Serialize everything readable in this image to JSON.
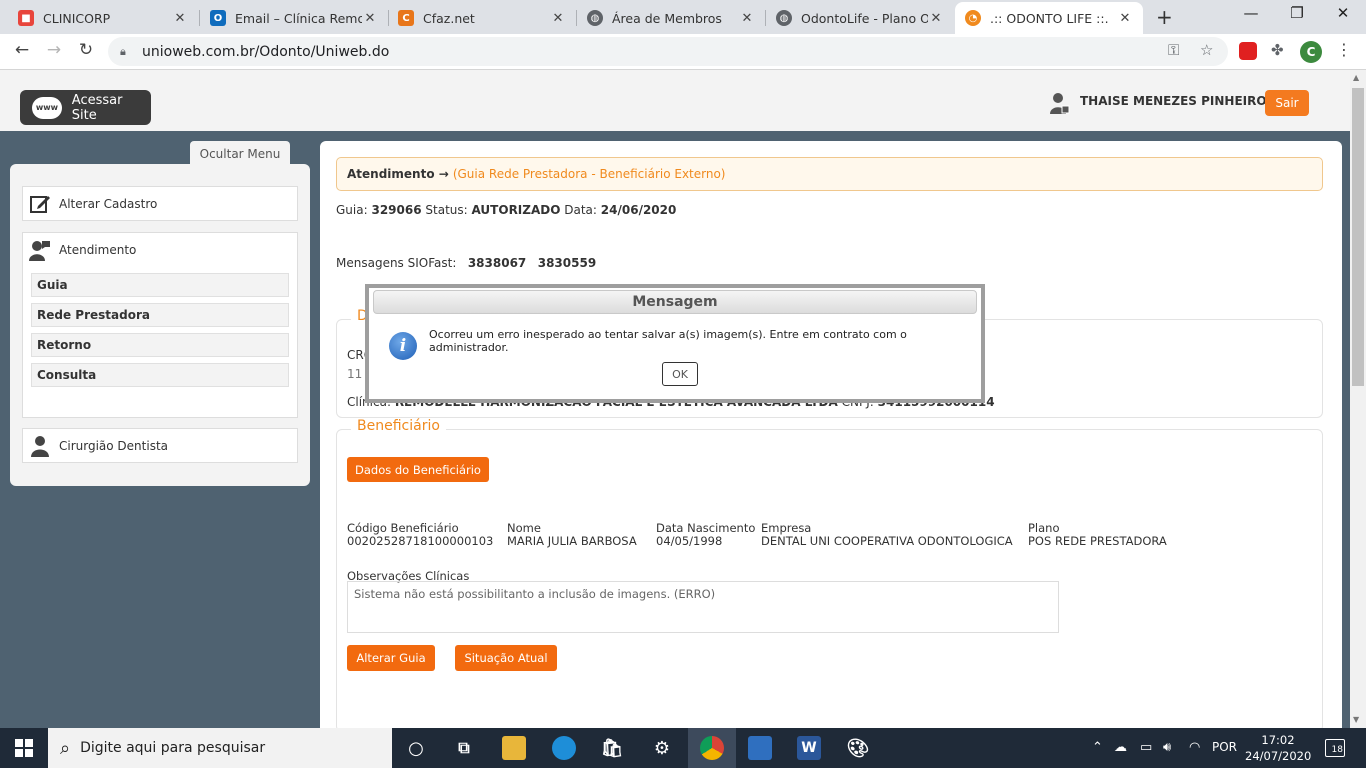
{
  "browser": {
    "tabs": [
      {
        "label": "CLINICORP",
        "icon": "clinicorp-icon",
        "color": "#e8453c"
      },
      {
        "label": "Email – Clínica Remodelle",
        "icon": "outlook-icon",
        "color": "#0f6cbd"
      },
      {
        "label": "Cfaz.net",
        "icon": "cfaz-icon",
        "color": "#e8761a"
      },
      {
        "label": "Área de Membros",
        "icon": "globe-icon",
        "color": "#5f6368"
      },
      {
        "label": "OdontoLife - Plano Odontológico",
        "icon": "globe-icon",
        "color": "#5f6368"
      },
      {
        "label": ".:: ODONTO LIFE ::.",
        "icon": "odontolife-icon",
        "color": "#f08a1e"
      }
    ],
    "new_tab": "+",
    "url": "unioweb.com.br/Odonto/Uniweb.do",
    "profile_initial": "C"
  },
  "header": {
    "site_button": "Acessar Site",
    "www_badge": "www",
    "user_name": "THAISE MENEZES PINHEIRO",
    "logout": "Sair"
  },
  "sidebar": {
    "hide_menu": "Ocultar Menu",
    "edit_profile": "Alterar Cadastro",
    "attendance": "Atendimento",
    "subitems": [
      "Guia",
      "Rede Prestadora",
      "Retorno",
      "Consulta"
    ],
    "dentist": "Cirurgião Dentista"
  },
  "main": {
    "breadcrumb_root": "Atendimento →",
    "breadcrumb_current": "(Guia Rede Prestadora - Beneficiário Externo)",
    "guia_label": "Guia:",
    "guia_value": "329066",
    "status_label": "Status:",
    "status_value": "AUTORIZADO",
    "date_label": "Data:",
    "date_value": "24/06/2020",
    "msgs_label": "Mensagens SIOFast:",
    "msgs_1": "3838067",
    "msgs_2": "3830559",
    "dentist_legend": "D",
    "cro_label": "CRO",
    "cro_value": "11",
    "clinic_label": "Clínica:",
    "clinic_value": "REMODELLE HARMONIZACAO FACIAL E ESTETICA AVANCADA LTDA",
    "cnpj_label": "CNPJ:",
    "cnpj_value": "34115992000114",
    "beneficiary_legend": "Beneficiário",
    "beneficiary_button": "Dados do Beneficiário",
    "fields": [
      {
        "label": "Código Beneficiário",
        "value": "00202528718100000103"
      },
      {
        "label": "Nome",
        "value": "MARIA JULIA BARBOSA"
      },
      {
        "label": "Data Nascimento",
        "value": "04/05/1998"
      },
      {
        "label": "Empresa",
        "value": "DENTAL UNI COOPERATIVA ODONTOLOGICA"
      },
      {
        "label": "Plano",
        "value": "POS REDE PRESTADORA"
      }
    ],
    "obs_label": "Observações Clínicas",
    "obs_value": "Sistema não está possibilitanto a inclusão de imagens. (ERRO)",
    "edit_button": "Alterar Guia",
    "status_button": "Situação Atual"
  },
  "modal": {
    "title": "Mensagem",
    "message": "Ocorreu um erro inesperado ao tentar salvar a(s) imagem(s). Entre em contrato com o administrador.",
    "ok": "OK"
  },
  "taskbar": {
    "search_placeholder": "Digite aqui para pesquisar",
    "language": "POR",
    "time": "17:02",
    "date": "24/07/2020",
    "notifications": "18"
  },
  "colors": {
    "accent": "#f26a0f",
    "breadcrumb_link": "#f08a1e",
    "page_bg": "#4f6271",
    "taskbar": "#1f2a38"
  }
}
